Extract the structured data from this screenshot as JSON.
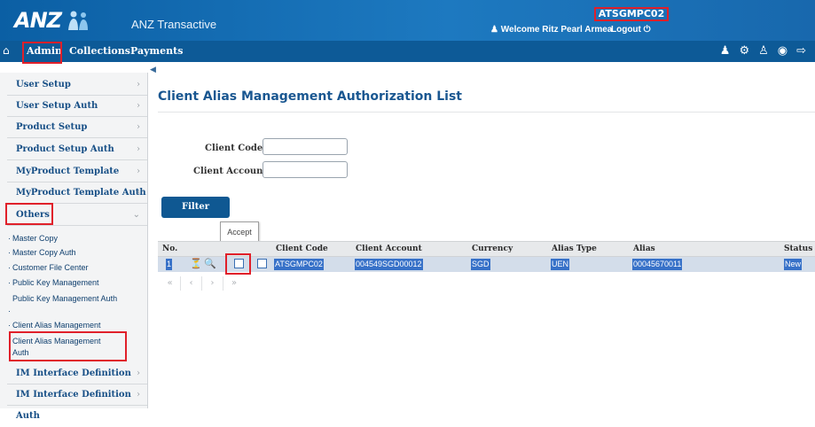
{
  "header": {
    "logo": "ANZ",
    "app_title": "ANZ Transactive",
    "user_id": "ATSGMPC02",
    "welcome": "Welcome Ritz Pearl Armea",
    "logout": "Logout"
  },
  "nav": {
    "items": [
      {
        "label": "Admin"
      },
      {
        "label": "Collections"
      },
      {
        "label": "Payments"
      }
    ],
    "right_icons": [
      "user-icon",
      "gear-icon",
      "users-icon",
      "globe-icon",
      "exit-icon"
    ]
  },
  "sidebar": {
    "items": [
      {
        "label": "User Setup"
      },
      {
        "label": "User Setup Auth"
      },
      {
        "label": "Product Setup"
      },
      {
        "label": "Product Setup Auth"
      },
      {
        "label": "MyProduct Template"
      },
      {
        "label": "MyProduct Template Auth"
      },
      {
        "label": "Others"
      }
    ],
    "subitems": [
      {
        "label": "Master Copy"
      },
      {
        "label": "Master Copy Auth"
      },
      {
        "label": "Customer File Center"
      },
      {
        "label": "Public Key Management"
      },
      {
        "label": "Public Key Management Auth"
      },
      {
        "label": "Client Alias Management"
      },
      {
        "label": "Client Alias Management Auth"
      }
    ],
    "bottom_items": [
      {
        "label": "IM Interface Definition"
      },
      {
        "label": "IM Interface Definition Auth"
      }
    ]
  },
  "main": {
    "title": "Client Alias Management Authorization List",
    "filters": {
      "client_code_label": "Client Code :",
      "client_code_value": "",
      "client_account_label": "Client Account :",
      "client_account_value": ""
    },
    "filter_button": "Filter",
    "tooltip": "Accept",
    "table": {
      "headers": [
        "No.",
        "Client Code",
        "Client Account",
        "Currency",
        "Alias Type",
        "Alias",
        "Status"
      ],
      "rows": [
        {
          "no": "1",
          "client_code": "ATSGMPC02",
          "client_account": "004549SGD00012",
          "currency": "SGD",
          "alias_type": "UEN",
          "alias": "00045670011",
          "status": "New"
        }
      ]
    }
  },
  "colors": {
    "header_blue": "#1d79c0",
    "nav_blue": "#0d5a97",
    "highlight_red": "#e0202a",
    "selected_cell": "#3771c8"
  }
}
